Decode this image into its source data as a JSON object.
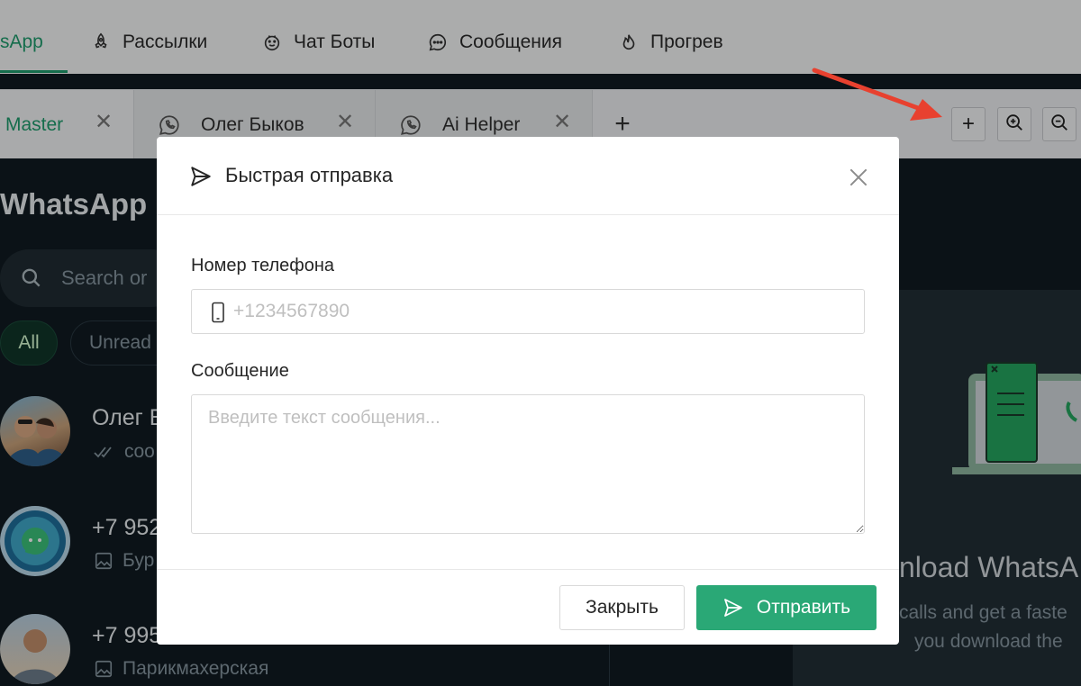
{
  "nav": {
    "items": [
      {
        "label": "sApp",
        "icon": "whatsapp-icon",
        "active": true
      },
      {
        "label": "Рассылки",
        "icon": "rocket-icon"
      },
      {
        "label": "Чат Боты",
        "icon": "bot-icon"
      },
      {
        "label": "Сообщения",
        "icon": "chat-bubble-icon"
      },
      {
        "label": "Прогрев",
        "icon": "flame-icon"
      }
    ]
  },
  "tabs": [
    {
      "label": "Master"
    },
    {
      "label": "Олег Быков"
    },
    {
      "label": "Ai Helper"
    }
  ],
  "toolbar": {
    "add_label": "+",
    "new_tab_label": "+"
  },
  "whatsapp": {
    "title": "WhatsApp",
    "search_placeholder": "Search or",
    "filters": [
      "All",
      "Unread"
    ],
    "chats": [
      {
        "name": "Олег Б",
        "preview": "coo"
      },
      {
        "name": "+7 952",
        "preview": "Бур"
      },
      {
        "name": "+7 995",
        "preview": "Парикмахерская"
      }
    ],
    "download_title": "nload WhatsA",
    "download_text1": "calls and get a faste",
    "download_text2": "you download the"
  },
  "modal": {
    "title": "Быстрая отправка",
    "phone_label": "Номер телефона",
    "phone_placeholder": "+1234567890",
    "message_label": "Сообщение",
    "message_placeholder": "Введите текст сообщения...",
    "close_label": "Закрыть",
    "send_label": "Отправить"
  },
  "colors": {
    "accent": "#2aa876",
    "nav_active": "#1f9d6e",
    "annotation_arrow": "#e8412f",
    "whatsapp_bg": "#111b21"
  }
}
